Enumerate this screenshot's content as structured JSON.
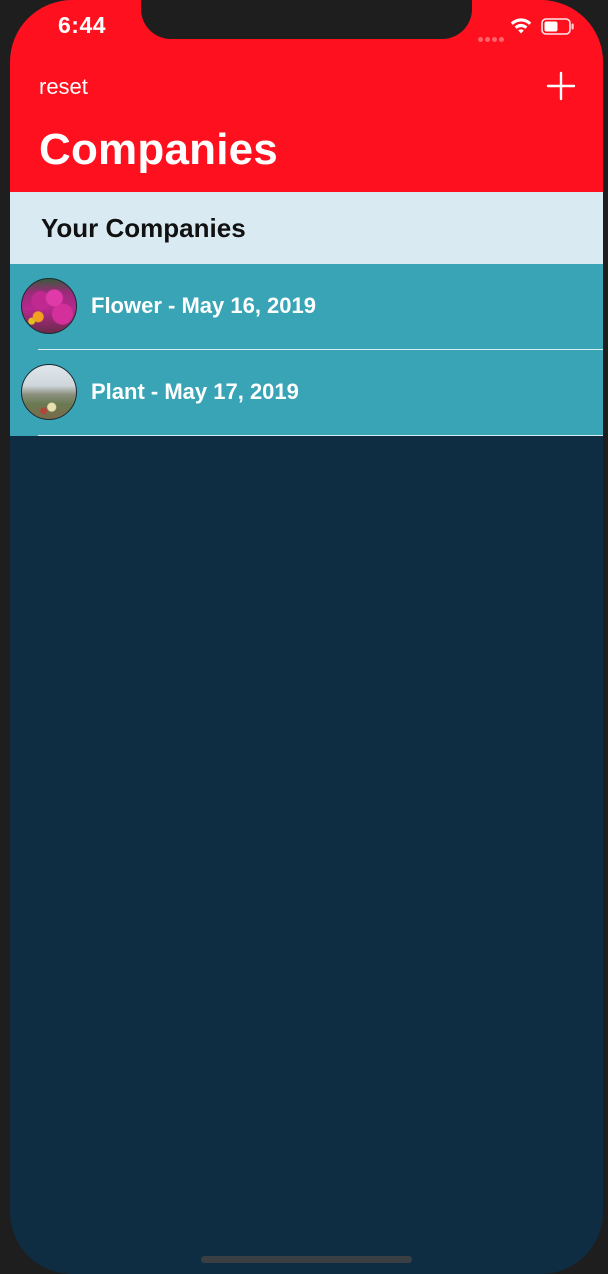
{
  "status_bar": {
    "time": "6:44"
  },
  "nav": {
    "reset_label": "reset",
    "add_icon": "plus-icon",
    "title": "Companies"
  },
  "section": {
    "title": "Your Companies"
  },
  "companies": [
    {
      "label": "Flower - May 16, 2019",
      "image": "flower-photo"
    },
    {
      "label": "Plant - May 17, 2019",
      "image": "plant-photo"
    }
  ],
  "colors": {
    "nav_bar": "#ff101f",
    "section_header": "#daeaf3",
    "row": "#38a4b6",
    "background": "#0f2d42"
  }
}
